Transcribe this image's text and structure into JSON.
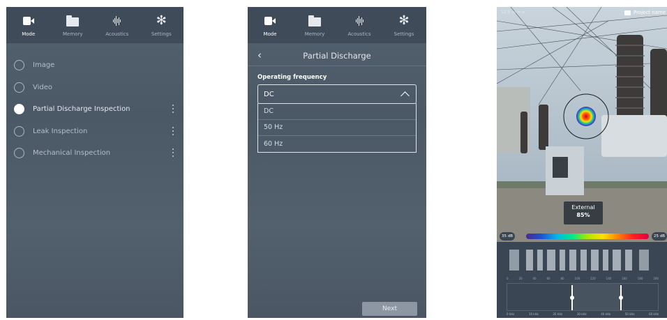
{
  "tabs": [
    {
      "label": "Mode",
      "icon": "camera-icon"
    },
    {
      "label": "Memory",
      "icon": "folder-icon"
    },
    {
      "label": "Acoustics",
      "icon": "waveform-icon"
    },
    {
      "label": "Settings",
      "icon": "gear-icon"
    }
  ],
  "mode_list": {
    "items": [
      {
        "label": "Image",
        "selected": false,
        "has_menu": false
      },
      {
        "label": "Video",
        "selected": false,
        "has_menu": false
      },
      {
        "label": "Partial Discharge Inspection",
        "selected": true,
        "has_menu": true
      },
      {
        "label": "Leak Inspection",
        "selected": false,
        "has_menu": true
      },
      {
        "label": "Mechanical Inspection",
        "selected": false,
        "has_menu": true
      }
    ]
  },
  "partial_discharge": {
    "title": "Partial Discharge",
    "field_label": "Operating frequency",
    "selected_value": "DC",
    "options": [
      "DC",
      "50 Hz",
      "60 Hz"
    ],
    "next_label": "Next"
  },
  "camera_view": {
    "status_text": "12:5   ▭  ≈  ⌂",
    "project_name": "Project name",
    "popup_label": "External",
    "popup_value": "85%",
    "scale_min": "35 dB",
    "scale_max": "25 dB",
    "spectrum_axis": [
      "0",
      "20",
      "40",
      "60",
      "80",
      "100",
      "120",
      "140",
      "160",
      "180",
      "200"
    ],
    "freq_axis": [
      "0 kHz",
      "10 kHz",
      "20 kHz",
      "30 kHz",
      "40 kHz",
      "50 kHz",
      "60 kHz"
    ]
  },
  "colors": {
    "background_panel": "#4f5c6a",
    "tab_bar": "#3f4b59",
    "accent": "#ffffff"
  }
}
